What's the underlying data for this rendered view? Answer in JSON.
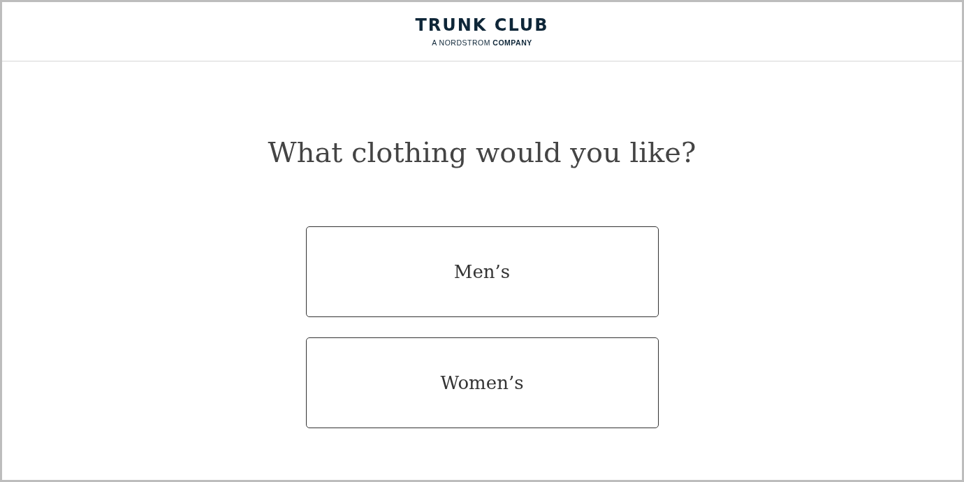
{
  "header": {
    "logo": "TRUNK CLUB",
    "tagline": "A NORDSTROM **COMPANY**"
  },
  "question": "What clothing would you like?",
  "options": [
    {
      "label": "Men’s"
    },
    {
      "label": "Women’s"
    }
  ]
}
